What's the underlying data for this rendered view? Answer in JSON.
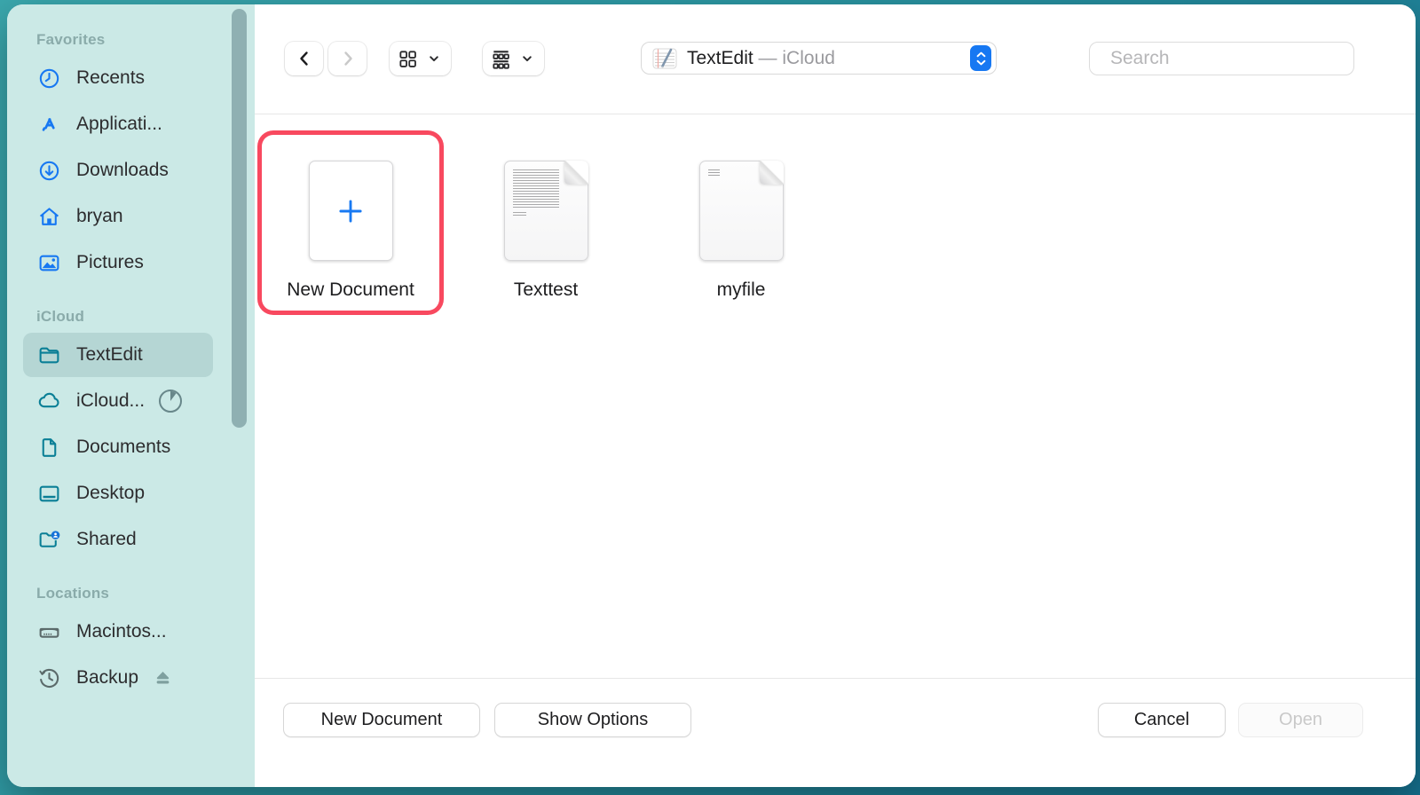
{
  "colors": {
    "accent_blue": "#1778f2",
    "sidebar_teal": "#cbe9e6",
    "icon_teal": "#0a7f96",
    "highlight_red": "#f8495f",
    "background_teal": "#2b96a2"
  },
  "toolbar": {
    "path_app": "TextEdit",
    "path_separator": "—",
    "path_location": "iCloud",
    "search_placeholder": "Search"
  },
  "sidebar": {
    "sections": [
      {
        "label": "Favorites",
        "items": [
          {
            "label": "Recents",
            "icon": "clock-icon"
          },
          {
            "label": "Applicati...",
            "icon": "app-store-icon"
          },
          {
            "label": "Downloads",
            "icon": "download-circle-icon"
          },
          {
            "label": "bryan",
            "icon": "home-icon"
          },
          {
            "label": "Pictures",
            "icon": "photo-icon"
          }
        ]
      },
      {
        "label": "iCloud",
        "items": [
          {
            "label": "TextEdit",
            "icon": "folder-icon",
            "selected": true
          },
          {
            "label": "iCloud...",
            "icon": "cloud-icon",
            "trailing": "sync-progress-pie"
          },
          {
            "label": "Documents",
            "icon": "document-icon"
          },
          {
            "label": "Desktop",
            "icon": "desktop-icon"
          },
          {
            "label": "Shared",
            "icon": "shared-folder-icon"
          }
        ]
      },
      {
        "label": "Locations",
        "items": [
          {
            "label": "Macintos...",
            "icon": "hard-drive-icon"
          },
          {
            "label": "Backup",
            "icon": "time-machine-icon",
            "trailing": "eject-icon"
          }
        ]
      }
    ]
  },
  "files": [
    {
      "name": "New Document",
      "type": "new-document-tile",
      "highlighted": true
    },
    {
      "name": "Texttest",
      "type": "text-document"
    },
    {
      "name": "myfile",
      "type": "text-document"
    }
  ],
  "footer": {
    "new_document_label": "New Document",
    "show_options_label": "Show Options",
    "cancel_label": "Cancel",
    "open_label": "Open"
  }
}
